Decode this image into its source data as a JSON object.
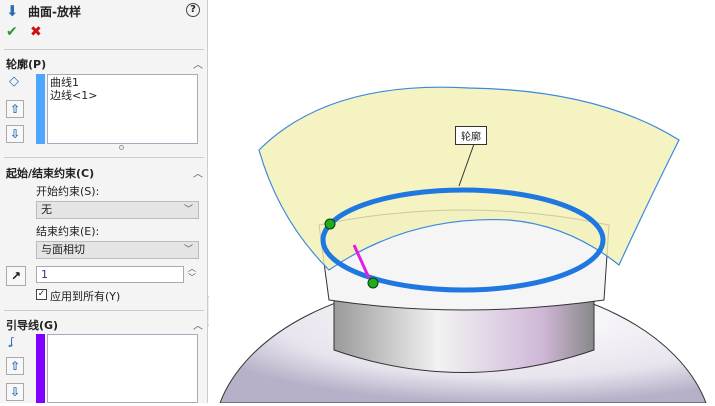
{
  "panel": {
    "title": "曲面-放样",
    "ok_icon": "check-icon",
    "cancel_icon": "close-icon",
    "help_icon": "help-icon",
    "profiles": {
      "header": "轮廓(P)",
      "items": [
        "曲线1",
        "边线<1>"
      ],
      "color": "#4da6ff"
    },
    "constraints": {
      "header": "起始/结束约束(C)",
      "start_label": "开始约束(S):",
      "start_value": "无",
      "end_label": "结束约束(E):",
      "end_value": "与面相切",
      "tangent_length": "1",
      "apply_all": "应用到所有(Y)",
      "apply_all_checked": true
    },
    "guides": {
      "header": "引导线(G)",
      "color": "#8000ff"
    }
  },
  "viewport": {
    "callout": "轮廓"
  }
}
